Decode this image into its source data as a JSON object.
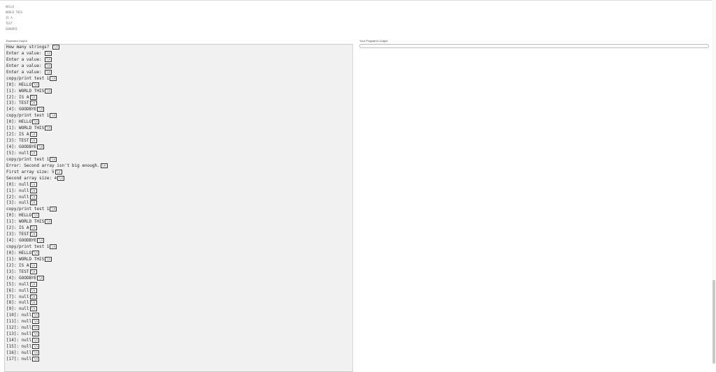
{
  "input_lines": [
    "HELLO",
    "WORLD THIS",
    "IS A",
    "TEST",
    "GOODBYE"
  ],
  "left_title": "Expected Output",
  "right_title": "Your Program's Output",
  "newline_marker": "\\n",
  "output_lines": [
    {
      "text": "How many strings? ",
      "nl": true
    },
    {
      "text": "Enter a value: ",
      "nl": true
    },
    {
      "text": "Enter a value: ",
      "nl": true
    },
    {
      "text": "Enter a value: ",
      "nl": true
    },
    {
      "text": "Enter a value: ",
      "nl": true
    },
    {
      "text": "copy/print test 1",
      "nl": true
    },
    {
      "text": "[0]: HELLO",
      "nl": true
    },
    {
      "text": "[1]: WORLD THIS",
      "nl": true
    },
    {
      "text": "[2]: IS A",
      "nl": true
    },
    {
      "text": "[3]: TEST",
      "nl": true
    },
    {
      "text": "[4]: GOODBYE",
      "nl": true
    },
    {
      "text": "copy/print test 1",
      "nl": true
    },
    {
      "text": "[0]: HELLO",
      "nl": true
    },
    {
      "text": "[1]: WORLD THIS",
      "nl": true
    },
    {
      "text": "[2]: IS A",
      "nl": true
    },
    {
      "text": "[3]: TEST",
      "nl": true
    },
    {
      "text": "[4]: GOODBYE",
      "nl": true
    },
    {
      "text": "[5]: null",
      "nl": true
    },
    {
      "text": "copy/print test 1",
      "nl": true
    },
    {
      "text": "Error: Second array isn't big enough.",
      "nl": true
    },
    {
      "text": "First array size: 5",
      "nl": true
    },
    {
      "text": "Second array size: 4",
      "nl": true
    },
    {
      "text": "[0]: null",
      "nl": true
    },
    {
      "text": "[1]: null",
      "nl": true
    },
    {
      "text": "[2]: null",
      "nl": true
    },
    {
      "text": "[3]: null",
      "nl": true
    },
    {
      "text": "copy/print test 1",
      "nl": true
    },
    {
      "text": "[0]: HELLO",
      "nl": true
    },
    {
      "text": "[1]: WORLD THIS",
      "nl": true
    },
    {
      "text": "[2]: IS A",
      "nl": true
    },
    {
      "text": "[3]: TEST",
      "nl": true
    },
    {
      "text": "[4]: GOODBYE",
      "nl": true
    },
    {
      "text": "copy/print test 1",
      "nl": true
    },
    {
      "text": "[0]: HELLO",
      "nl": true
    },
    {
      "text": "[1]: WORLD THIS",
      "nl": true
    },
    {
      "text": "[2]: IS A",
      "nl": true
    },
    {
      "text": "[3]: TEST",
      "nl": true
    },
    {
      "text": "[4]: GOODBYE",
      "nl": true
    },
    {
      "text": "[5]: null",
      "nl": true
    },
    {
      "text": "[6]: null",
      "nl": true
    },
    {
      "text": "[7]: null",
      "nl": true
    },
    {
      "text": "[8]: null",
      "nl": true
    },
    {
      "text": "[9]: null",
      "nl": true
    },
    {
      "text": "[10]: null",
      "nl": true
    },
    {
      "text": "[11]: null",
      "nl": true
    },
    {
      "text": "[12]: null",
      "nl": true
    },
    {
      "text": "[13]: null",
      "nl": true
    },
    {
      "text": "[14]: null",
      "nl": true
    },
    {
      "text": "[15]: null",
      "nl": true
    },
    {
      "text": "[16]: null",
      "nl": true
    },
    {
      "text": "[17]: null",
      "nl": true
    }
  ]
}
